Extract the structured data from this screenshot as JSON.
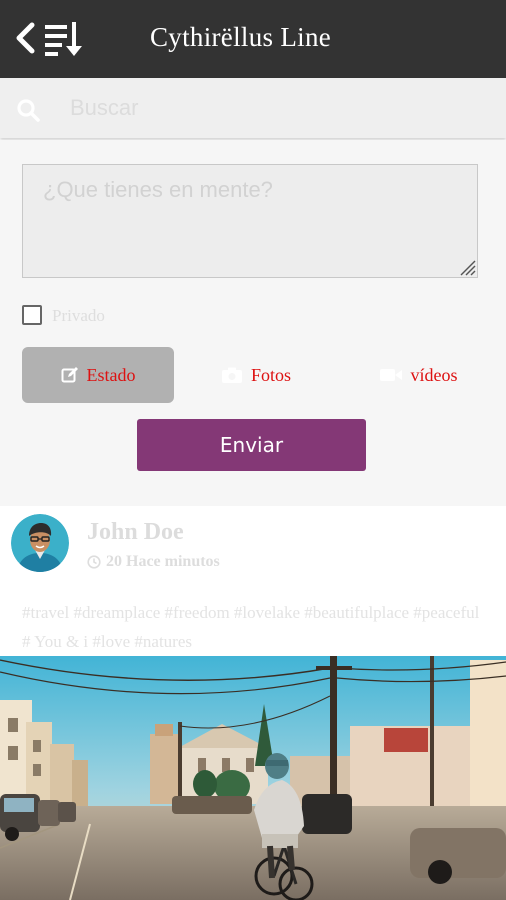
{
  "header": {
    "title": "Cythirëllus Line",
    "back_icon": "chevron-left-icon",
    "sort_icon": "sort-list-down-icon"
  },
  "search": {
    "placeholder": "Buscar",
    "icon": "search-icon"
  },
  "composer": {
    "placeholder": "¿Que tienes en mente?",
    "private_label": "Privado",
    "tabs": [
      {
        "label": "Estado",
        "icon": "edit-icon"
      },
      {
        "label": "Fotos",
        "icon": "camera-icon"
      },
      {
        "label": "vídeos",
        "icon": "video-camera-icon"
      }
    ],
    "submit_label": "Enviar"
  },
  "post": {
    "author": "John Doe",
    "time": "20 Hace minutos",
    "tags": "#travel #dreamplace #freedom #lovelake #beautifulplace #peaceful # You & i #love #natures"
  },
  "colors": {
    "appbar": "#333333",
    "accent": "#843876",
    "tab_text": "#dd1111",
    "tab_active_bg": "#b1b1b1"
  }
}
